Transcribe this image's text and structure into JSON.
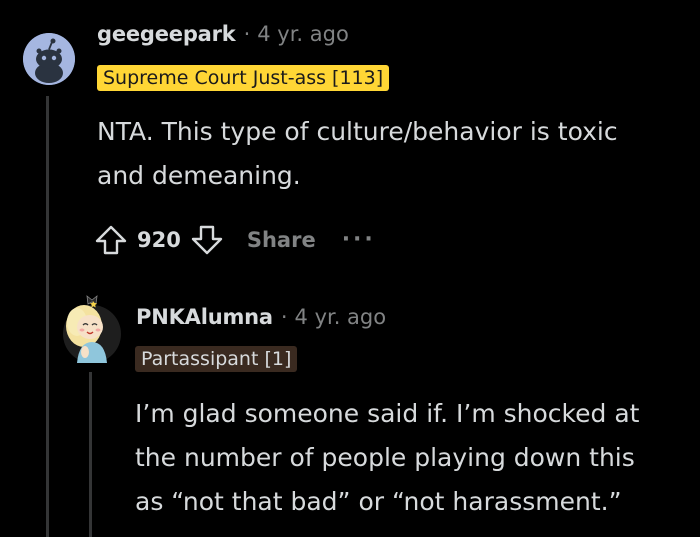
{
  "comments": [
    {
      "username": "geegeepark",
      "separator": "·",
      "time": "4 yr. ago",
      "flair": {
        "text": "Supreme Court Just-ass [113]",
        "bg": "#ffd635",
        "fg": "#1a1a1b"
      },
      "avatar_icon": "snoo-default-avatar-icon",
      "body_lines": [
        "NTA. This type of culture/behavior is toxic",
        "and demeaning."
      ],
      "score": "920",
      "share_label": "Share",
      "more_label": "···"
    },
    {
      "username": "PNKAlumna",
      "separator": "·",
      "time": "4 yr. ago",
      "flair": {
        "text": "Partassipant [1]",
        "bg": "#3a2a20",
        "fg": "#d7dadc"
      },
      "avatar_icon": "blonde-character-avatar-icon",
      "body_lines": [
        "I’m glad someone said if. I’m shocked at",
        "the number of people playing down this",
        "as “not that bad” or “not harassment.”"
      ]
    }
  ],
  "colors": {
    "background": "#000000",
    "text": "#d7dadc",
    "muted": "#818384",
    "thread_line": "#343536"
  }
}
